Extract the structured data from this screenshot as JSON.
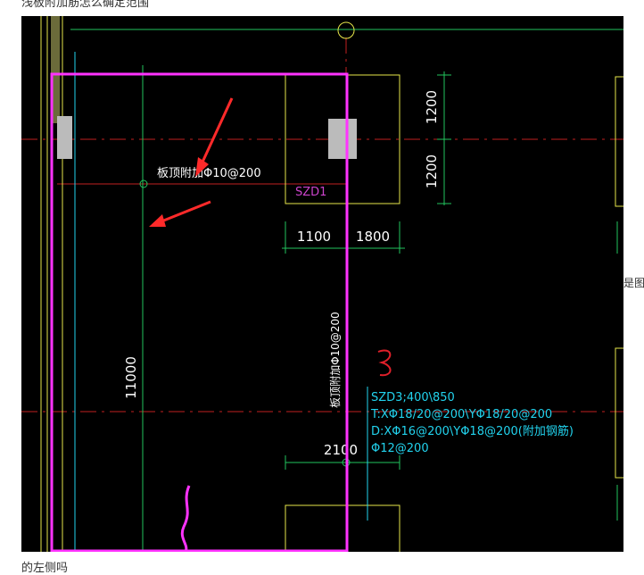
{
  "captions": {
    "top": "浅板附加筋怎么确定范围",
    "side": "是图",
    "bottom": "的左侧吗"
  },
  "drawing": {
    "dims": {
      "v_top": "1200",
      "v_bottom": "1200",
      "h_left": "1100",
      "h_right": "1800",
      "long_vertical": "11000",
      "h_lower": "2100"
    },
    "labels": {
      "rebar_top": "板顶附加Φ10@200",
      "slab_tag": "SZD1",
      "rebar_vertical": "板顶附加Φ10@200"
    },
    "column_note": {
      "line1": "SZD3;400\\850",
      "line2": "T:XΦ18/20@200\\YΦ18/20@200",
      "line3": "D:XΦ16@200\\YΦ18@200(附加钢筋)",
      "line4": "Φ12@200"
    },
    "colors": {
      "background": "#000000",
      "dim": "#22c55e",
      "text": "#ffffff",
      "magenta": "#ff33ff",
      "red_axis": "#c0201f",
      "note": "#22d3ee",
      "yellow": "#e6e64a",
      "arrow": "#ff2a2a"
    }
  }
}
